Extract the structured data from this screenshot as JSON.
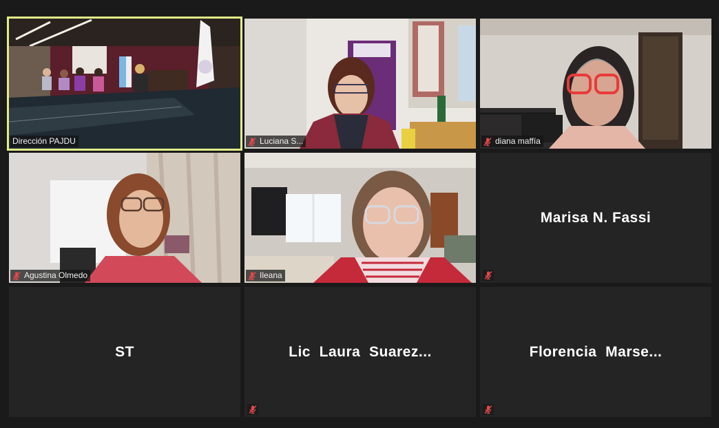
{
  "participants": [
    {
      "name": "Dirección PAJDU",
      "video": true,
      "muted": false,
      "active_speaker": true
    },
    {
      "name": "Luciana S...",
      "video": true,
      "muted": true,
      "active_speaker": false
    },
    {
      "name": "diana maffía",
      "video": true,
      "muted": true,
      "active_speaker": false
    },
    {
      "name": "Agustina Olmedo",
      "video": true,
      "muted": true,
      "active_speaker": false
    },
    {
      "name": "Ileana",
      "video": true,
      "muted": true,
      "active_speaker": false
    },
    {
      "name": "Marisa N. Fassi",
      "video": false,
      "muted": true,
      "active_speaker": false
    },
    {
      "name": "ST",
      "video": false,
      "muted": false,
      "active_speaker": false
    },
    {
      "name": "Lic  Laura  Suarez...",
      "video": false,
      "muted": true,
      "active_speaker": false
    },
    {
      "name": "Florencia  Marse...",
      "video": false,
      "muted": true,
      "active_speaker": false
    }
  ],
  "icons": {
    "muted": "muted-mic-icon"
  },
  "colors": {
    "active_border": "#e3ee8a",
    "muted_icon": "#e5484d",
    "tile_background": "#242424",
    "app_background": "#1a1a1a"
  }
}
